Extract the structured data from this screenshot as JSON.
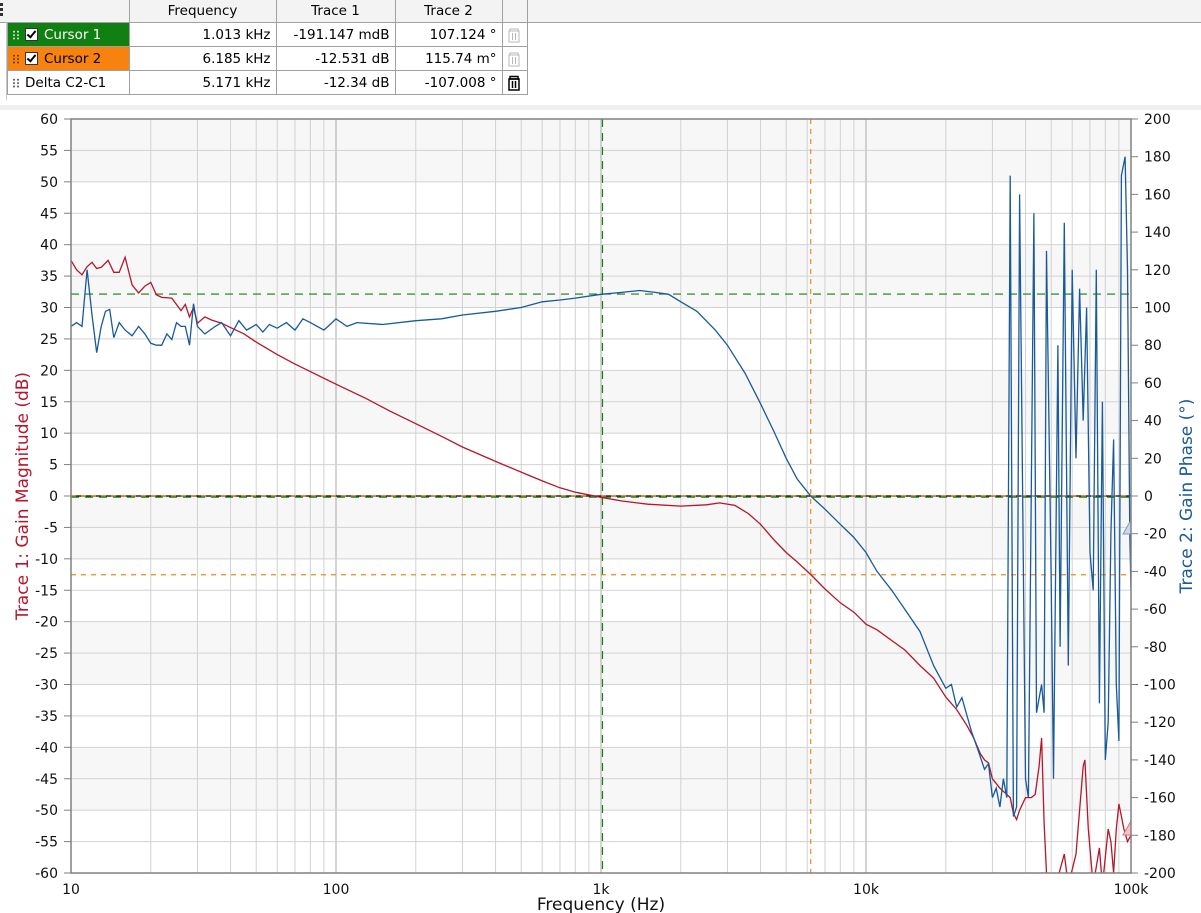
{
  "cursor_table": {
    "headers": [
      "",
      "Frequency",
      "Trace 1",
      "Trace 2"
    ],
    "rows": [
      {
        "name": "Cursor 1",
        "checked": true,
        "color": "#118012",
        "frequency": "1.013 kHz",
        "trace1": "-191.147 mdB",
        "trace2": "107.124 °",
        "delete_icon": "trash-icon-disabled"
      },
      {
        "name": "Cursor 2",
        "checked": true,
        "color": "#f7820e",
        "frequency": "6.185 kHz",
        "trace1": "-12.531 dB",
        "trace2": "115.74 m°",
        "delete_icon": "trash-icon-disabled"
      },
      {
        "name": "Delta C2-C1",
        "checked": null,
        "color": "#ffffff",
        "frequency": "5.171 kHz",
        "trace1": "-12.34 dB",
        "trace2": "-107.008 °",
        "delete_icon": "trash-icon"
      }
    ]
  },
  "colors": {
    "trace1": "#b5162b",
    "trace2": "#185a9a",
    "cursor1": "#1a7d1a",
    "cursor2": "#f08a1e",
    "grid": "#d2d2d2"
  },
  "chart_data": {
    "type": "line",
    "title": "",
    "xlabel": "Frequency (Hz)",
    "ylabel": "Trace 1: Gain Magnitude (dB)",
    "y2label": "Trace 2: Gain Phase (°)",
    "xscale": "log",
    "xlim": [
      10,
      100000
    ],
    "ylim": [
      -60,
      60
    ],
    "y2lim": [
      -200,
      200
    ],
    "grid": true,
    "x_ticks": [
      {
        "v": 10,
        "label": "10"
      },
      {
        "v": 100,
        "label": "100"
      },
      {
        "v": 1000,
        "label": "1k"
      },
      {
        "v": 10000,
        "label": "10k"
      },
      {
        "v": 100000,
        "label": "100k"
      }
    ],
    "y_ticks": [
      60,
      55,
      50,
      45,
      40,
      35,
      30,
      25,
      20,
      15,
      10,
      5,
      0,
      -5,
      -10,
      -15,
      -20,
      -25,
      -30,
      -35,
      -40,
      -45,
      -50,
      -55,
      -60
    ],
    "y2_ticks": [
      200,
      180,
      160,
      140,
      120,
      100,
      80,
      60,
      40,
      20,
      0,
      -20,
      -40,
      -60,
      -80,
      -100,
      -120,
      -140,
      -160,
      -180,
      -200
    ],
    "cursors": [
      {
        "name": "Cursor 1",
        "x": 1013,
        "y1": -0.191,
        "y2": 107.124
      },
      {
        "name": "Cursor 2",
        "x": 6185,
        "y1": -12.531,
        "y2": 0.116
      }
    ],
    "series": [
      {
        "name": "Trace 1: Gain Magnitude",
        "axis": "left",
        "points": [
          [
            10,
            37.5
          ],
          [
            10.5,
            36
          ],
          [
            11,
            35.2
          ],
          [
            11.5,
            36.5
          ],
          [
            12,
            37.2
          ],
          [
            12.5,
            36.2
          ],
          [
            13,
            36.4
          ],
          [
            13.8,
            37.5
          ],
          [
            14.5,
            35.6
          ],
          [
            15.2,
            35.6
          ],
          [
            16,
            38
          ],
          [
            17,
            33.6
          ],
          [
            18,
            32.3
          ],
          [
            19,
            33.4
          ],
          [
            20,
            34
          ],
          [
            21,
            32
          ],
          [
            22,
            31.6
          ],
          [
            24,
            31.5
          ],
          [
            26,
            29.5
          ],
          [
            27,
            30.5
          ],
          [
            28,
            28.5
          ],
          [
            29,
            30
          ],
          [
            30,
            27.5
          ],
          [
            32,
            28.5
          ],
          [
            34,
            28
          ],
          [
            37,
            27.5
          ],
          [
            40,
            26.8
          ],
          [
            45,
            25.8
          ],
          [
            50,
            24.5
          ],
          [
            60,
            22.5
          ],
          [
            70,
            21
          ],
          [
            80,
            19.8
          ],
          [
            100,
            17.8
          ],
          [
            130,
            15.5
          ],
          [
            160,
            13.5
          ],
          [
            200,
            11.5
          ],
          [
            250,
            9.5
          ],
          [
            300,
            7.8
          ],
          [
            400,
            5.5
          ],
          [
            500,
            3.8
          ],
          [
            600,
            2.4
          ],
          [
            700,
            1.3
          ],
          [
            800,
            0.6
          ],
          [
            1000,
            -0.2
          ],
          [
            1200,
            -0.8
          ],
          [
            1500,
            -1.3
          ],
          [
            2000,
            -1.6
          ],
          [
            2500,
            -1.4
          ],
          [
            2800,
            -1.1
          ],
          [
            3200,
            -1.5
          ],
          [
            3600,
            -2.8
          ],
          [
            4000,
            -4.5
          ],
          [
            4500,
            -7
          ],
          [
            5000,
            -9
          ],
          [
            5500,
            -10.5
          ],
          [
            6185,
            -12.5
          ],
          [
            7000,
            -14.8
          ],
          [
            8000,
            -17
          ],
          [
            9000,
            -18.5
          ],
          [
            10000,
            -20.4
          ],
          [
            11000,
            -21.3
          ],
          [
            12500,
            -23
          ],
          [
            14000,
            -24.5
          ],
          [
            16000,
            -27
          ],
          [
            18000,
            -29
          ],
          [
            20000,
            -32
          ],
          [
            22000,
            -34
          ],
          [
            24000,
            -36.5
          ],
          [
            25500,
            -38.5
          ],
          [
            27000,
            -41
          ],
          [
            28000,
            -42
          ],
          [
            29000,
            -42.5
          ],
          [
            30000,
            -45
          ],
          [
            32000,
            -46.5
          ],
          [
            33000,
            -47
          ],
          [
            35000,
            -48
          ],
          [
            36000,
            -50.5
          ],
          [
            37000,
            -51.5
          ],
          [
            38000,
            -50
          ],
          [
            40000,
            -48
          ],
          [
            42000,
            -48
          ],
          [
            43500,
            -47.5
          ],
          [
            45000,
            -43
          ],
          [
            46000,
            -38.5
          ],
          [
            47000,
            -52
          ],
          [
            48000,
            -60
          ],
          [
            52000,
            -62
          ],
          [
            56000,
            -57
          ],
          [
            58000,
            -62
          ],
          [
            62000,
            -57
          ],
          [
            66000,
            -43
          ],
          [
            67000,
            -42
          ],
          [
            69000,
            -53
          ],
          [
            72000,
            -62
          ],
          [
            76000,
            -56
          ],
          [
            78000,
            -62
          ],
          [
            82000,
            -53
          ],
          [
            84000,
            -55
          ],
          [
            86000,
            -60
          ],
          [
            88000,
            -53
          ],
          [
            90000,
            -49
          ],
          [
            94000,
            -53
          ],
          [
            97000,
            -55
          ],
          [
            100000,
            -54
          ]
        ]
      },
      {
        "name": "Trace 2: Gain Phase",
        "axis": "right",
        "points": [
          [
            10,
            90
          ],
          [
            10.5,
            92
          ],
          [
            11,
            90
          ],
          [
            11.5,
            120
          ],
          [
            12,
            96
          ],
          [
            12.5,
            76
          ],
          [
            13,
            90
          ],
          [
            13.5,
            98
          ],
          [
            14,
            99
          ],
          [
            14.5,
            84
          ],
          [
            15.2,
            92
          ],
          [
            16,
            88
          ],
          [
            17,
            85
          ],
          [
            18,
            90
          ],
          [
            19,
            86
          ],
          [
            20,
            81
          ],
          [
            21,
            80
          ],
          [
            22,
            80
          ],
          [
            23,
            86
          ],
          [
            24,
            83
          ],
          [
            25,
            92
          ],
          [
            26,
            90
          ],
          [
            27,
            90
          ],
          [
            28,
            80
          ],
          [
            29,
            102
          ],
          [
            30,
            90
          ],
          [
            32,
            86
          ],
          [
            35,
            90
          ],
          [
            37,
            92
          ],
          [
            40,
            85
          ],
          [
            43,
            93
          ],
          [
            46,
            88
          ],
          [
            50,
            91
          ],
          [
            53,
            87
          ],
          [
            56,
            91
          ],
          [
            60,
            89
          ],
          [
            65,
            92
          ],
          [
            70,
            88
          ],
          [
            75,
            94
          ],
          [
            80,
            92
          ],
          [
            90,
            88
          ],
          [
            95,
            91
          ],
          [
            100,
            94
          ],
          [
            110,
            90
          ],
          [
            120,
            92
          ],
          [
            150,
            91
          ],
          [
            200,
            93
          ],
          [
            250,
            94
          ],
          [
            300,
            96
          ],
          [
            400,
            98
          ],
          [
            500,
            100
          ],
          [
            600,
            103
          ],
          [
            700,
            104
          ],
          [
            800,
            105
          ],
          [
            1000,
            107
          ],
          [
            1200,
            108
          ],
          [
            1400,
            109
          ],
          [
            1600,
            108
          ],
          [
            1800,
            107
          ],
          [
            2000,
            103
          ],
          [
            2300,
            98
          ],
          [
            2700,
            88
          ],
          [
            3000,
            80
          ],
          [
            3500,
            65
          ],
          [
            4000,
            49
          ],
          [
            4500,
            34
          ],
          [
            5000,
            20
          ],
          [
            5500,
            9
          ],
          [
            6185,
            0
          ],
          [
            7000,
            -7
          ],
          [
            8000,
            -15
          ],
          [
            9000,
            -22
          ],
          [
            10000,
            -30
          ],
          [
            11000,
            -40
          ],
          [
            12500,
            -50
          ],
          [
            14000,
            -60
          ],
          [
            16000,
            -72
          ],
          [
            18000,
            -90
          ],
          [
            20000,
            -102
          ],
          [
            21000,
            -100
          ],
          [
            22000,
            -112
          ],
          [
            23000,
            -107
          ],
          [
            25000,
            -125
          ],
          [
            26500,
            -135
          ],
          [
            28000,
            -145
          ],
          [
            29000,
            -142
          ],
          [
            30000,
            -160
          ],
          [
            31000,
            -155
          ],
          [
            32000,
            -165
          ],
          [
            33000,
            -150
          ],
          [
            34000,
            -160
          ],
          [
            35000,
            170
          ],
          [
            36000,
            -170
          ],
          [
            37000,
            -165
          ],
          [
            38000,
            160
          ],
          [
            40000,
            -150
          ],
          [
            41000,
            -160
          ],
          [
            43000,
            150
          ],
          [
            44000,
            -115
          ],
          [
            46000,
            -100
          ],
          [
            47000,
            -115
          ],
          [
            48000,
            130
          ],
          [
            50000,
            -45
          ],
          [
            51000,
            -150
          ],
          [
            53000,
            80
          ],
          [
            54000,
            -80
          ],
          [
            56000,
            145
          ],
          [
            58000,
            -90
          ],
          [
            60000,
            120
          ],
          [
            62000,
            20
          ],
          [
            64000,
            110
          ],
          [
            66000,
            40
          ],
          [
            68000,
            100
          ],
          [
            70000,
            -30
          ],
          [
            72000,
            -50
          ],
          [
            74000,
            120
          ],
          [
            76000,
            -110
          ],
          [
            78000,
            50
          ],
          [
            80000,
            -140
          ],
          [
            82000,
            -120
          ],
          [
            84000,
            -20
          ],
          [
            86000,
            30
          ],
          [
            88000,
            -100
          ],
          [
            90000,
            -130
          ],
          [
            92000,
            170
          ],
          [
            95000,
            180
          ],
          [
            97000,
            120
          ],
          [
            99000,
            -20
          ],
          [
            100000,
            -50
          ]
        ]
      }
    ],
    "markers": [
      {
        "series": "Trace 2: Gain Phase",
        "value": -17,
        "shape": "triangle"
      },
      {
        "series": "Trace 1: Gain Magnitude",
        "value": -53,
        "shape": "triangle"
      }
    ]
  }
}
